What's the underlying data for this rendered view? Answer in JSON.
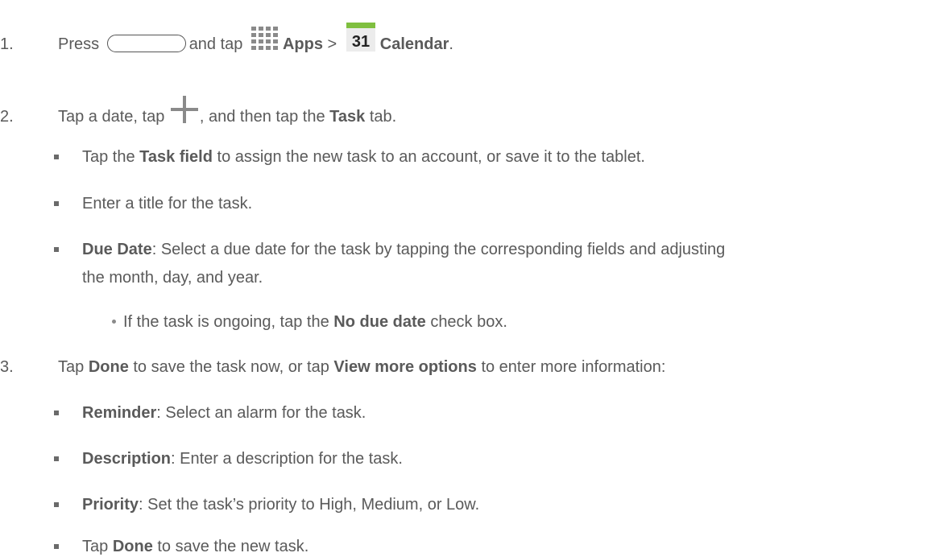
{
  "steps": {
    "s1": {
      "num": "1.",
      "t1": "Press",
      "t2": "and tap",
      "apps": "Apps",
      "gt": ">",
      "cal_num": "31",
      "calendar": "Calendar",
      "end": "."
    },
    "s2": {
      "num": "2.",
      "t1": "Tap a date, tap",
      "t2": ", and then tap the",
      "task": "Task",
      "t3": "tab."
    },
    "s2_bullets": {
      "b1_t1": "Tap the",
      "b1_bold": "Task field",
      "b1_t2": "to assign the new task to an account, or save it to the tablet.",
      "b2": "Enter a title for the task.",
      "b3_bold": "Due Date",
      "b3_t1": ": Select a due date for the task by tapping the corresponding fields and adjusting",
      "b3_t2": "the month, day, and year.",
      "sub_t1": "If the task is ongoing, tap the",
      "sub_bold": "No due date",
      "sub_t2": "check box."
    },
    "s3": {
      "num": "3.",
      "t1": "Tap",
      "done": "Done",
      "t2": "to save the task now, or tap",
      "view_more": "View more options",
      "t3": "to enter more information:"
    },
    "s3_bullets": {
      "b1_bold": "Reminder",
      "b1_t": ": Select an alarm for the task.",
      "b2_bold": "Description",
      "b2_t": ": Enter a description for the task.",
      "b3_bold": "Priority",
      "b3_t": ": Set the task’s priority to High, Medium, or Low.",
      "b4_t1": "Tap",
      "b4_bold": "Done",
      "b4_t2": "to save the new task."
    }
  },
  "icons": {
    "home": "home-button-icon",
    "apps": "apps-grid-icon",
    "calendar": "calendar-icon",
    "plus": "plus-icon"
  },
  "colors": {
    "calendar_green": "#7fbf3f"
  }
}
